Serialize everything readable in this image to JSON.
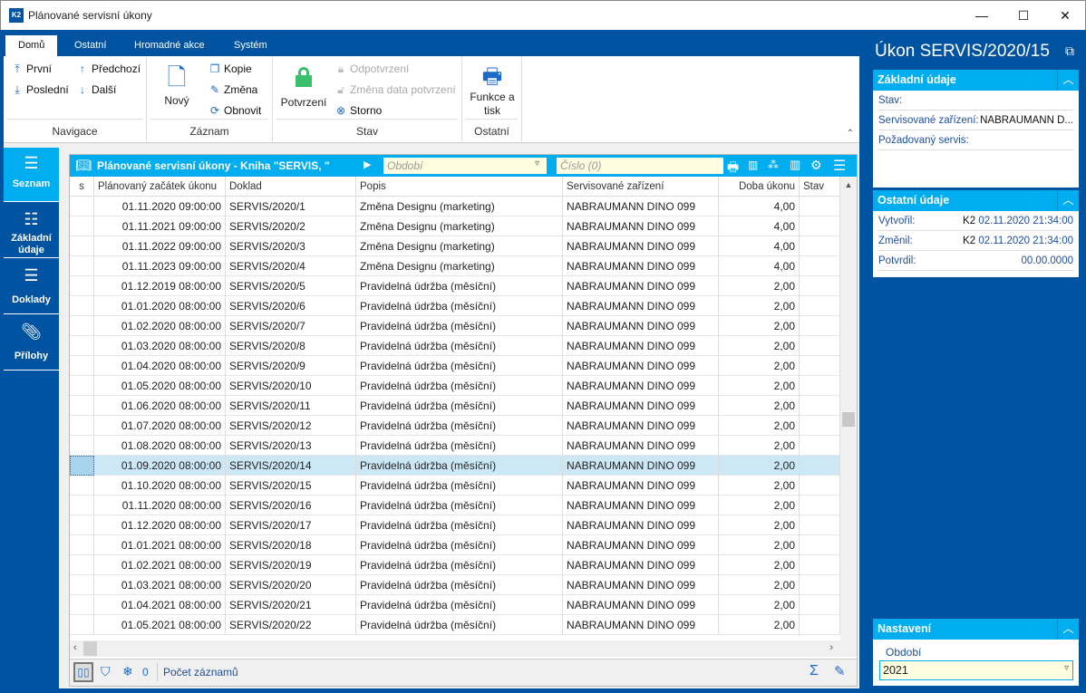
{
  "window": {
    "title": "Plánované servisní úkony",
    "logo": "K2"
  },
  "ribbon": {
    "tabs": [
      "Domů",
      "Ostatní",
      "Hromadné akce",
      "Systém"
    ],
    "groups": {
      "navigace": "Navigace",
      "zaznam": "Záznam",
      "stav": "Stav",
      "ostatni": "Ostatní"
    },
    "buttons": {
      "prvni": "První",
      "posledni": "Poslední",
      "predchozi": "Předchozí",
      "dalsi": "Další",
      "novy": "Nový",
      "kopie": "Kopie",
      "zmena": "Změna",
      "obnovit": "Obnovit",
      "potvrzeni": "Potvrzení",
      "odpotvrzeni": "Odpotvrzení",
      "zmena_data": "Změna data potvrzení",
      "storno": "Storno",
      "funkce": "Funkce a tisk"
    }
  },
  "nav": [
    "Seznam",
    "Základní údaje",
    "Doklady",
    "Přílohy"
  ],
  "grid": {
    "title": "Plánované servisní úkony - Kniha \"SERVIS, \"",
    "period_placeholder": "Období",
    "number_placeholder": "Číslo (0)",
    "columns": [
      "s",
      "Plánovaný začátek úkonu",
      "Doklad",
      "Popis",
      "Servisované zařízení",
      "Doba úkonu",
      "Stav"
    ],
    "selected_index": 13,
    "rows": [
      [
        "01.11.2020 09:00:00",
        "SERVIS/2020/1",
        "Změna Designu (marketing)",
        "NABRAUMANN DINO 099",
        "4,00"
      ],
      [
        "01.11.2021 09:00:00",
        "SERVIS/2020/2",
        "Změna Designu (marketing)",
        "NABRAUMANN DINO 099",
        "4,00"
      ],
      [
        "01.11.2022 09:00:00",
        "SERVIS/2020/3",
        "Změna Designu (marketing)",
        "NABRAUMANN DINO 099",
        "4,00"
      ],
      [
        "01.11.2023 09:00:00",
        "SERVIS/2020/4",
        "Změna Designu (marketing)",
        "NABRAUMANN DINO 099",
        "4,00"
      ],
      [
        "01.12.2019 08:00:00",
        "SERVIS/2020/5",
        "Pravidelná údržba (měsíční)",
        "NABRAUMANN DINO 099",
        "2,00"
      ],
      [
        "01.01.2020 08:00:00",
        "SERVIS/2020/6",
        "Pravidelná údržba (měsíční)",
        "NABRAUMANN DINO 099",
        "2,00"
      ],
      [
        "01.02.2020 08:00:00",
        "SERVIS/2020/7",
        "Pravidelná údržba (měsíční)",
        "NABRAUMANN DINO 099",
        "2,00"
      ],
      [
        "01.03.2020 08:00:00",
        "SERVIS/2020/8",
        "Pravidelná údržba (měsíční)",
        "NABRAUMANN DINO 099",
        "2,00"
      ],
      [
        "01.04.2020 08:00:00",
        "SERVIS/2020/9",
        "Pravidelná údržba (měsíční)",
        "NABRAUMANN DINO 099",
        "2,00"
      ],
      [
        "01.05.2020 08:00:00",
        "SERVIS/2020/10",
        "Pravidelná údržba (měsíční)",
        "NABRAUMANN DINO 099",
        "2,00"
      ],
      [
        "01.06.2020 08:00:00",
        "SERVIS/2020/11",
        "Pravidelná údržba (měsíční)",
        "NABRAUMANN DINO 099",
        "2,00"
      ],
      [
        "01.07.2020 08:00:00",
        "SERVIS/2020/12",
        "Pravidelná údržba (měsíční)",
        "NABRAUMANN DINO 099",
        "2,00"
      ],
      [
        "01.08.2020 08:00:00",
        "SERVIS/2020/13",
        "Pravidelná údržba (měsíční)",
        "NABRAUMANN DINO 099",
        "2,00"
      ],
      [
        "01.09.2020 08:00:00",
        "SERVIS/2020/14",
        "Pravidelná údržba (měsíční)",
        "NABRAUMANN DINO 099",
        "2,00"
      ],
      [
        "01.10.2020 08:00:00",
        "SERVIS/2020/15",
        "Pravidelná údržba (měsíční)",
        "NABRAUMANN DINO 099",
        "2,00"
      ],
      [
        "01.11.2020 08:00:00",
        "SERVIS/2020/16",
        "Pravidelná údržba (měsíční)",
        "NABRAUMANN DINO 099",
        "2,00"
      ],
      [
        "01.12.2020 08:00:00",
        "SERVIS/2020/17",
        "Pravidelná údržba (měsíční)",
        "NABRAUMANN DINO 099",
        "2,00"
      ],
      [
        "01.01.2021 08:00:00",
        "SERVIS/2020/18",
        "Pravidelná údržba (měsíční)",
        "NABRAUMANN DINO 099",
        "2,00"
      ],
      [
        "01.02.2021 08:00:00",
        "SERVIS/2020/19",
        "Pravidelná údržba (měsíční)",
        "NABRAUMANN DINO 099",
        "2,00"
      ],
      [
        "01.03.2021 08:00:00",
        "SERVIS/2020/20",
        "Pravidelná údržba (měsíční)",
        "NABRAUMANN DINO 099",
        "2,00"
      ],
      [
        "01.04.2021 08:00:00",
        "SERVIS/2020/21",
        "Pravidelná údržba (měsíční)",
        "NABRAUMANN DINO 099",
        "2,00"
      ],
      [
        "01.05.2021 08:00:00",
        "SERVIS/2020/22",
        "Pravidelná údržba (měsíční)",
        "NABRAUMANN DINO 099",
        "2,00"
      ]
    ],
    "footer": {
      "count": "0",
      "records_label": "Počet záznamů"
    }
  },
  "detail": {
    "title": "Úkon SERVIS/2020/15",
    "basic": {
      "header": "Základní údaje",
      "stav_label": "Stav:",
      "zarizeni_label": "Servisované zařízení:",
      "zarizeni_value": "NABRAUMANN D...",
      "servis_label": "Požadovaný servis:"
    },
    "other": {
      "header": "Ostatní údaje",
      "vytvoril_label": "Vytvořil:",
      "vytvoril_user": "K2",
      "vytvoril_date": "02.11.2020 21:34:00",
      "zmenil_label": "Změnil:",
      "zmenil_user": "K2",
      "zmenil_date": "02.11.2020 21:34:00",
      "potvrdil_label": "Potvrdil:",
      "potvrdil_date": "00.00.0000"
    },
    "settings": {
      "header": "Nastavení",
      "obdobi_label": "Období",
      "obdobi_value": "2021"
    }
  }
}
